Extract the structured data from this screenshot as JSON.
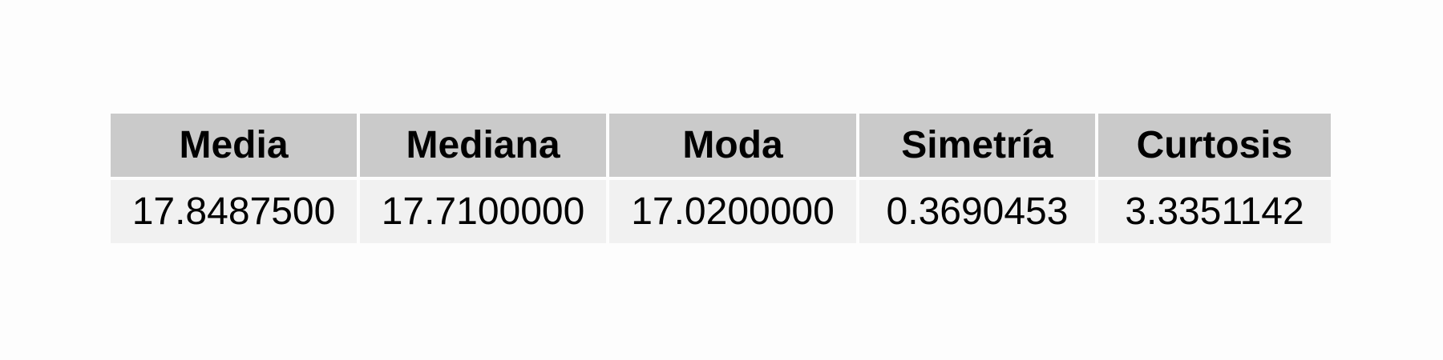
{
  "chart_data": {
    "type": "table",
    "columns": [
      "Media",
      "Mediana",
      "Moda",
      "Simetría",
      "Curtosis"
    ],
    "rows": [
      [
        "17.8487500",
        "17.7100000",
        "17.0200000",
        "0.3690453",
        "3.3351142"
      ]
    ]
  },
  "colors": {
    "header_background": "#cacaca",
    "cell_background": "#f1f1f1",
    "page_background": "#fdfdfd",
    "text": "#000000"
  }
}
